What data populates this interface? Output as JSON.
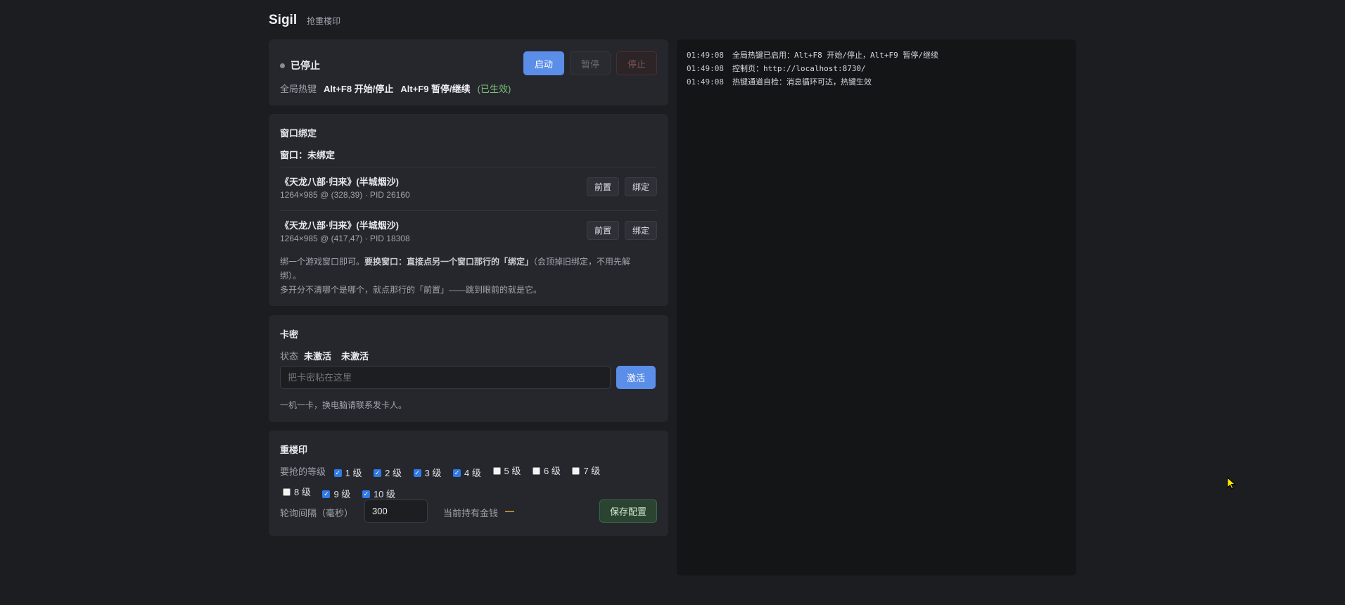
{
  "app": {
    "title": "Sigil",
    "subtitle": "抢重楼印"
  },
  "status": {
    "state": "已停止",
    "buttons": {
      "start": "启动",
      "pause": "暂停",
      "stop": "停止"
    },
    "hotkey_label": "全局热键",
    "hotkey_start": "Alt+F8 开始/停止",
    "hotkey_pause": "Alt+F9 暂停/继续",
    "hotkey_state": "(已生效)"
  },
  "window_binding": {
    "title": "窗口绑定",
    "current_label": "窗口：未绑定",
    "windows": [
      {
        "name": "《天龙八部·归来》(半城烟沙)",
        "meta": "1264×985 @ (328,39) · PID 26160",
        "front": "前置",
        "bind": "绑定"
      },
      {
        "name": "《天龙八部·归来》(半城烟沙)",
        "meta": "1264×985 @ (417,47) · PID 18308",
        "front": "前置",
        "bind": "绑定"
      }
    ],
    "help_1a": "绑一个游戏窗口即可。",
    "help_1b": "要换窗口：直接点另一个窗口那行的「绑定」",
    "help_1c": "（会顶掉旧绑定，不用先解绑）。",
    "help_2": "多开分不清哪个是哪个，就点那行的「前置」——跳到眼前的就是它。"
  },
  "card": {
    "title": "卡密",
    "status_label": "状态",
    "status_value_1": "未激活",
    "status_value_2": "未激活",
    "input_placeholder": "把卡密粘在这里",
    "activate": "激活",
    "note": "一机一卡，换电脑请联系发卡人。"
  },
  "seal": {
    "title": "重楼印",
    "levels_label": "要抢的等级",
    "levels": [
      {
        "label": "1 级",
        "checked": true
      },
      {
        "label": "2 级",
        "checked": true
      },
      {
        "label": "3 级",
        "checked": true
      },
      {
        "label": "4 级",
        "checked": true
      },
      {
        "label": "5 级",
        "checked": false
      },
      {
        "label": "6 级",
        "checked": false
      },
      {
        "label": "7 级",
        "checked": false
      },
      {
        "label": "8 级",
        "checked": false
      },
      {
        "label": "9 级",
        "checked": true
      },
      {
        "label": "10 级",
        "checked": true
      }
    ],
    "interval_label": "轮询间隔（毫秒）",
    "interval_value": "300",
    "money_label": "当前持有金钱",
    "money_value": "—",
    "save": "保存配置"
  },
  "log": [
    {
      "time": "01:49:08",
      "text": "全局热键已启用：Alt+F8 开始/停止，Alt+F9 暂停/继续"
    },
    {
      "time": "01:49:08",
      "text": "控制页：http://localhost:8730/"
    },
    {
      "time": "01:49:08",
      "text": "热键通道自检：消息循环可达，热键生效"
    }
  ],
  "colors": {
    "accent": "#5a8ee8",
    "ok": "#7cc37a",
    "money": "#e8a93a",
    "cursor": "#ffe600"
  }
}
